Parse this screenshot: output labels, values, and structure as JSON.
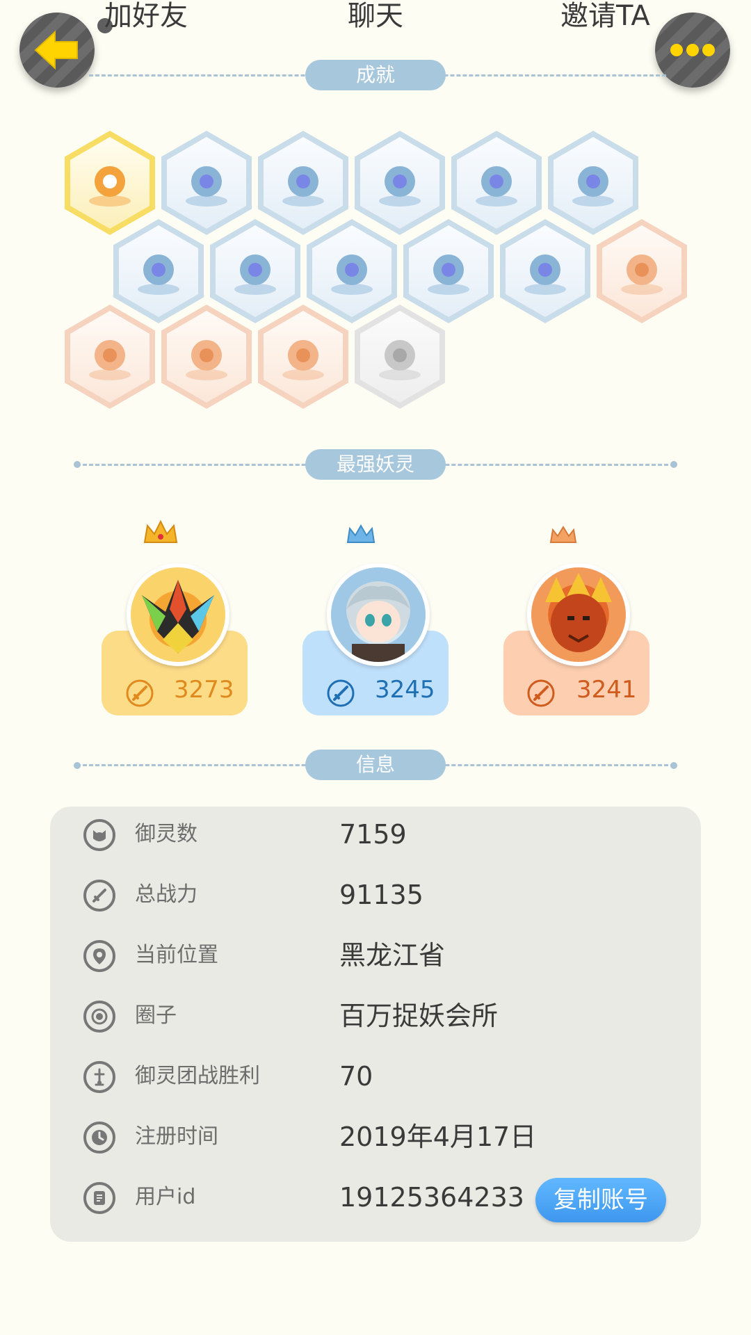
{
  "top_bar": {
    "add_friend": "加好友",
    "chat": "聊天",
    "invite": "邀请TA"
  },
  "sections": {
    "achievements": "成就",
    "strongest_spirits": "最强妖灵",
    "info": "信息"
  },
  "achievements": [
    {
      "icon": "cat-medal-icon",
      "tier": "gold"
    },
    {
      "icon": "sneaker-icon",
      "tier": "blue"
    },
    {
      "icon": "portal-icon",
      "tier": "blue"
    },
    {
      "icon": "moon-icon",
      "tier": "blue"
    },
    {
      "icon": "crystal-ball-icon",
      "tier": "blue"
    },
    {
      "icon": "crystal-icon",
      "tier": "blue"
    },
    {
      "icon": "yinyang-wave-icon",
      "tier": "blue"
    },
    {
      "icon": "dancing-cat-icon",
      "tier": "blue"
    },
    {
      "icon": "yinyang-book-icon",
      "tier": "blue"
    },
    {
      "icon": "shield-portal-icon",
      "tier": "blue"
    },
    {
      "icon": "cat-statue-icon",
      "tier": "blue"
    },
    {
      "icon": "fire-spirit-icon",
      "tier": "orange"
    },
    {
      "icon": "cat-cart-icon",
      "tier": "orange"
    },
    {
      "icon": "koi-fish-icon",
      "tier": "orange"
    },
    {
      "icon": "horned-spirit-icon",
      "tier": "orange"
    },
    {
      "icon": "wolf-book-icon",
      "tier": "grey"
    }
  ],
  "strongest_spirits": [
    {
      "power": "3273",
      "theme": "gold",
      "accent": "#e08a1e",
      "card": "#fddc88"
    },
    {
      "power": "3245",
      "theme": "blue",
      "accent": "#1e6fb3",
      "card": "#bfe0fb"
    },
    {
      "power": "3241",
      "theme": "orange",
      "accent": "#cf5b1d",
      "card": "#fdceb0"
    }
  ],
  "info": {
    "rows": [
      {
        "icon": "spirit-face-icon",
        "label": "御灵数",
        "value": "7159"
      },
      {
        "icon": "sword-power-icon",
        "label": "总战力",
        "value": "91135"
      },
      {
        "icon": "location-pin-icon",
        "label": "当前位置",
        "value": "黑龙江省"
      },
      {
        "icon": "circle-target-icon",
        "label": "圈子",
        "value": "百万捉妖会所"
      },
      {
        "icon": "team-sword-icon",
        "label": "御灵团战胜利",
        "value": "70"
      },
      {
        "icon": "clock-icon",
        "label": "注册时间",
        "value": "2019年4月17日"
      },
      {
        "icon": "id-card-icon",
        "label": "用户id",
        "value": "19125364233"
      }
    ],
    "copy_button": "复制账号"
  },
  "colors": {
    "background": "#fdfdf3",
    "section_pill": "#a6c7dc",
    "copy_button": "#4aa6f7",
    "back_arrow": "#ffd400"
  }
}
